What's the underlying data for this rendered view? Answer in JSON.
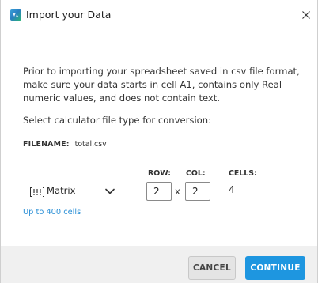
{
  "window": {
    "title": "Import your Data",
    "close_label": "Close"
  },
  "content": {
    "intro": "Prior to importing your spreadsheet saved in csv file format, make sure your data starts in cell A1, contains only Real numeric values, and does not contain text.",
    "select_label": "Select calculator file type for conversion:",
    "filename_label": "FILENAME:",
    "filename_value": "total.csv"
  },
  "grid": {
    "row_header": "ROW:",
    "col_header": "COL:",
    "cells_header": "CELLS:",
    "type_selected": "Matrix",
    "rows": "2",
    "cols": "2",
    "times": "x",
    "cells": "4",
    "limit_text": "Up to 400 cells"
  },
  "footer": {
    "cancel_label": "CANCEL",
    "continue_label": "CONTINUE"
  },
  "colors": {
    "accent": "#1e96e0",
    "link": "#2a8fd6",
    "footer_bg": "#f0f0f0"
  },
  "icons": {
    "app": "ti-app-icon",
    "close": "close-icon",
    "type": "matrix-icon",
    "dropdown": "chevron-down-icon"
  }
}
